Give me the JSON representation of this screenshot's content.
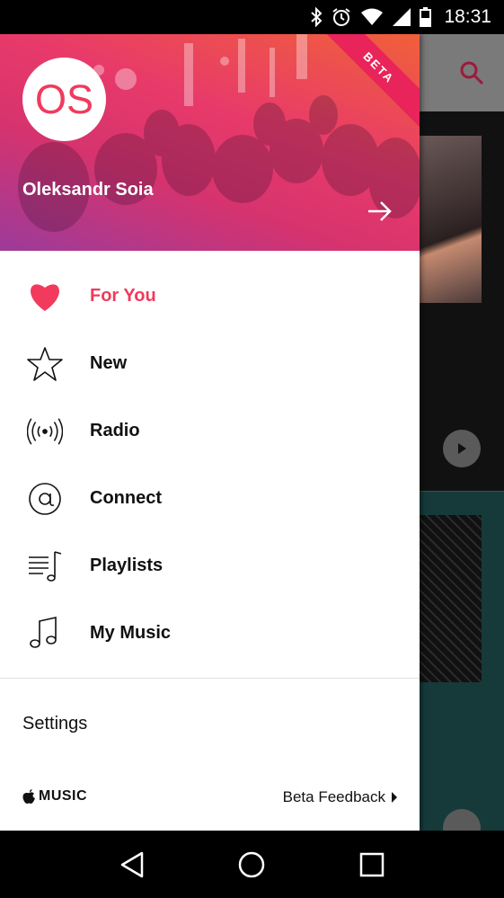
{
  "status_bar": {
    "time": "18:31",
    "icons": [
      "bluetooth-icon",
      "alarm-icon",
      "wifi-icon",
      "signal-icon",
      "battery-icon"
    ]
  },
  "drawer": {
    "header": {
      "avatar_initials": "OS",
      "user_name": "Oleksandr Soia",
      "beta_badge": "BETA"
    },
    "menu_items": [
      {
        "label": "For You",
        "icon": "heart-icon",
        "active": true
      },
      {
        "label": "New",
        "icon": "star-icon",
        "active": false
      },
      {
        "label": "Radio",
        "icon": "radio-icon",
        "active": false
      },
      {
        "label": "Connect",
        "icon": "at-icon",
        "active": false
      },
      {
        "label": "Playlists",
        "icon": "playlist-icon",
        "active": false
      },
      {
        "label": "My Music",
        "icon": "music-note-icon",
        "active": false
      }
    ],
    "settings_label": "Settings",
    "footer": {
      "brand": "MUSIC",
      "feedback_label": "Beta Feedback"
    }
  },
  "colors": {
    "accent": "#f13a5c",
    "header_gradient": [
      "#f0603a",
      "#e83a6a",
      "#9c3b9a"
    ]
  }
}
